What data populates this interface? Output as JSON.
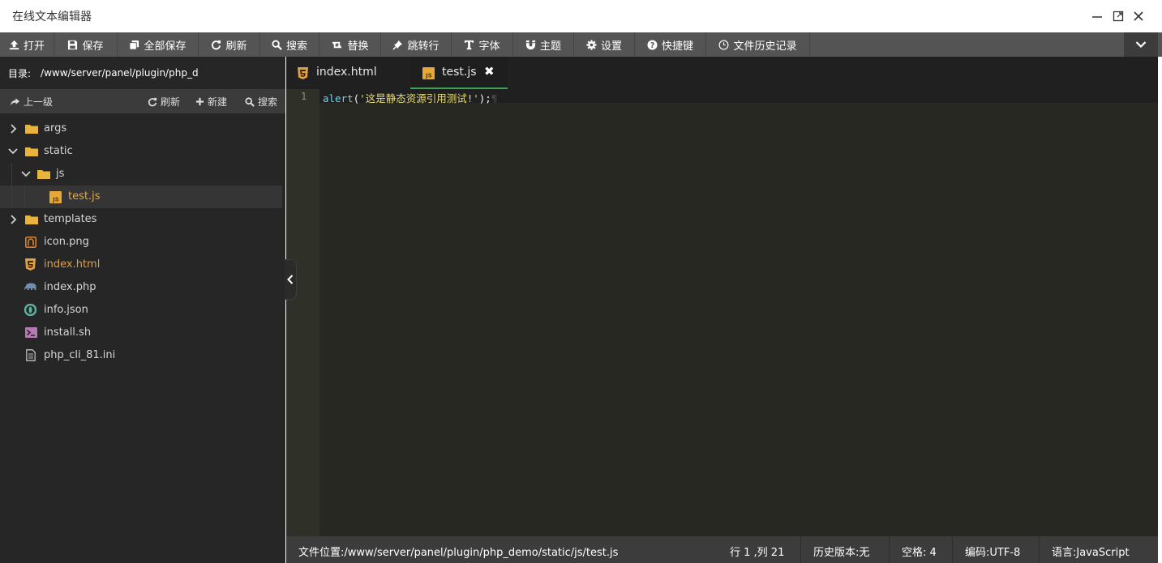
{
  "window": {
    "title": "在线文本编辑器"
  },
  "toolbar": {
    "items": [
      {
        "label": "打开",
        "icon": "upload-icon"
      },
      {
        "label": "保存",
        "icon": "save-icon"
      },
      {
        "label": "全部保存",
        "icon": "copy-icon"
      },
      {
        "label": "刷新",
        "icon": "refresh-icon"
      },
      {
        "label": "搜索",
        "icon": "search-icon"
      },
      {
        "label": "替换",
        "icon": "retweet-icon"
      },
      {
        "label": "跳转行",
        "icon": "pushpin-icon"
      },
      {
        "label": "字体",
        "icon": "text-height-icon"
      },
      {
        "label": "主题",
        "icon": "magnet-icon"
      },
      {
        "label": "设置",
        "icon": "gear-icon"
      },
      {
        "label": "快捷键",
        "icon": "question-circle-icon"
      },
      {
        "label": "文件历史记录",
        "icon": "clock-icon"
      }
    ]
  },
  "sidebar": {
    "dir_label": "目录:",
    "dir_path": "/www/server/panel/plugin/php_d",
    "actions": {
      "up": "上一级",
      "refresh": "刷新",
      "new": "新建",
      "search": "搜索"
    },
    "tree": [
      {
        "name": "args",
        "type": "folder",
        "expanded": false,
        "depth": 0
      },
      {
        "name": "static",
        "type": "folder",
        "expanded": true,
        "depth": 0
      },
      {
        "name": "js",
        "type": "folder",
        "expanded": true,
        "depth": 1
      },
      {
        "name": "test.js",
        "type": "js",
        "depth": 2,
        "active": true
      },
      {
        "name": "templates",
        "type": "folder",
        "expanded": false,
        "depth": 0
      },
      {
        "name": "icon.png",
        "type": "image",
        "depth": 0
      },
      {
        "name": "index.html",
        "type": "html",
        "depth": 0
      },
      {
        "name": "index.php",
        "type": "php",
        "depth": 0
      },
      {
        "name": "info.json",
        "type": "json",
        "depth": 0
      },
      {
        "name": "install.sh",
        "type": "shell",
        "depth": 0
      },
      {
        "name": "php_cli_81.ini",
        "type": "text",
        "depth": 0
      }
    ]
  },
  "tabs": [
    {
      "label": "index.html",
      "icon": "html5-icon",
      "active": false
    },
    {
      "label": "test.js",
      "icon": "js-file-icon",
      "active": true,
      "close": "✖"
    }
  ],
  "editor": {
    "line_number": "1",
    "code": {
      "fn": "alert",
      "open": "(",
      "string": "'这是静态资源引用测试!'",
      "close": ");",
      "pilcrow": "¶"
    }
  },
  "status": {
    "path": "文件位置:/www/server/panel/plugin/php_demo/static/js/test.js",
    "position": "行 1 ,列 21",
    "history": "历史版本:无",
    "indent": "空格: 4",
    "encoding": "编码:UTF-8",
    "language": "语言:JavaScript"
  },
  "colors": {
    "toolbar_bg": "#545454",
    "sidebar_bg": "#262626",
    "editor_bg": "#272822",
    "active_tab_underline": "#3aa655",
    "folder": "#e8b53a",
    "html_file": "#e1a046"
  }
}
